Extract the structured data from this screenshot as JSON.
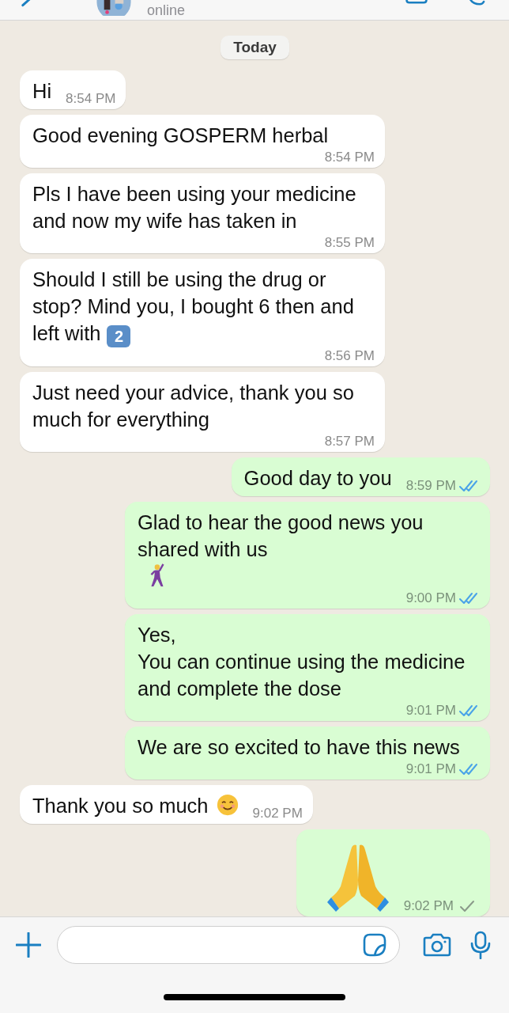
{
  "header": {
    "status": "online"
  },
  "date_divider": "Today",
  "messages": [
    {
      "kind": "incoming",
      "parts": [
        {
          "kind": "text",
          "text": "Hi"
        }
      ],
      "time": "8:54 PM"
    },
    {
      "kind": "incoming",
      "parts": [
        {
          "kind": "text",
          "text": "Good evening GOSPERM herbal"
        }
      ],
      "time": "8:54 PM"
    },
    {
      "kind": "incoming",
      "parts": [
        {
          "kind": "text",
          "text": "Pls I have been using your medicine and now my wife has taken in"
        }
      ],
      "time": "8:55 PM"
    },
    {
      "kind": "incoming",
      "parts": [
        {
          "kind": "text",
          "text": "Should I still be using the drug or stop? Mind you, I bought 6 then and left with"
        },
        {
          "kind": "keycap",
          "text": "2"
        }
      ],
      "time": "8:56 PM"
    },
    {
      "kind": "incoming",
      "parts": [
        {
          "kind": "text",
          "text": "Just need your advice, thank you so much for everything"
        }
      ],
      "time": "8:57 PM"
    },
    {
      "kind": "outgoing",
      "parts": [
        {
          "kind": "text",
          "text": "Good day to you"
        }
      ],
      "time": "8:59 PM",
      "read": true
    },
    {
      "kind": "outgoing",
      "parts": [
        {
          "kind": "text",
          "text": "Glad to hear the good news you shared with us"
        },
        {
          "kind": "dancer"
        }
      ],
      "time": "9:00 PM",
      "read": true
    },
    {
      "kind": "outgoing",
      "parts": [
        {
          "kind": "text",
          "text": "Yes,\nYou can continue using the medicine and complete the dose"
        }
      ],
      "time": "9:01 PM",
      "read": true
    },
    {
      "kind": "outgoing",
      "parts": [
        {
          "kind": "text",
          "text": "We are so excited to have this news"
        }
      ],
      "time": "9:01 PM",
      "read": true
    },
    {
      "kind": "incoming",
      "parts": [
        {
          "kind": "text",
          "text": "Thank you so much"
        },
        {
          "kind": "smile"
        }
      ],
      "time": "9:02 PM"
    },
    {
      "kind": "outgoing",
      "parts": [
        {
          "kind": "pray"
        }
      ],
      "time": "9:02 PM",
      "read": false
    }
  ]
}
